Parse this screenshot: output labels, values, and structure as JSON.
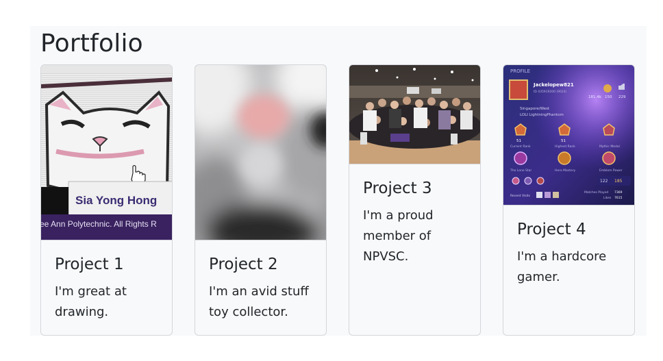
{
  "section": {
    "title": "Portfolio"
  },
  "projects": [
    {
      "title": "Project 1",
      "text": "I'm great at drawing.",
      "image_label": "Sia Yong Hong",
      "image_footer": "ee Ann Polytechnic. All Rights R"
    },
    {
      "title": "Project 2",
      "text": "I'm an avid stuff toy collector."
    },
    {
      "title": "Project 3",
      "text": "I'm a proud member of NPVSC."
    },
    {
      "title": "Project 4",
      "text": "I'm a hardcore gamer.",
      "game": {
        "profile": "PROFILE",
        "username": "Jackelopew821",
        "id_line": "ID 435919200 (9024)",
        "location": "Singapore/West",
        "squad": "LOLI LightningPhantom",
        "stat1": "181.4k",
        "stat2": "150",
        "stat3": "229",
        "badge1_value": "51",
        "badge1_label": "Current Rank",
        "badge2_value": "51",
        "badge2_label": "Highest Rank",
        "badge3_label": "Mythic Medal",
        "badge4_label": "The Lone Star",
        "badge5_label": "Hero Mastery",
        "badge6_label": "Emblem Power",
        "emblem_value1": "122",
        "emblem_value2": "185",
        "recent_visits": "Recent Visits",
        "matches_label": "Matches Played",
        "matches_value": "7369",
        "likes_label": "Likes",
        "likes_value": "7615"
      }
    }
  ],
  "colors": {
    "section_bg": "#f8f9fa",
    "card_border": "#d3d6da",
    "text": "#212529",
    "game_accent": "#b18cff"
  }
}
